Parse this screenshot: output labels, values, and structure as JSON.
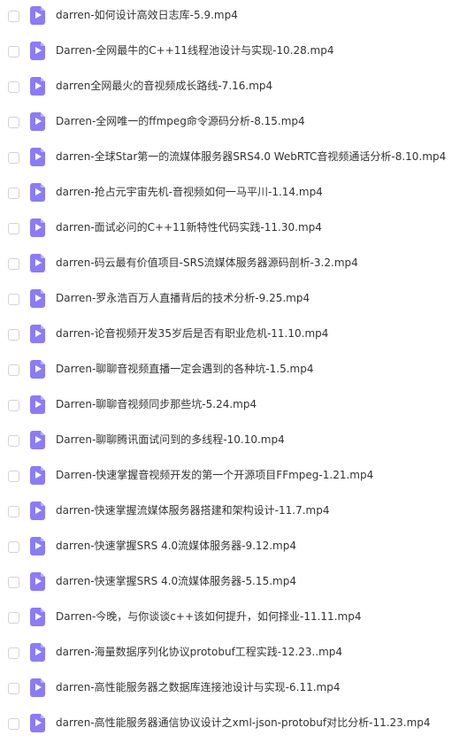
{
  "files": [
    {
      "name": "darren-如何设计高效日志库-5.9.mp4",
      "icon": "video-file-icon"
    },
    {
      "name": "Darren-全网最牛的C++11线程池设计与实现-10.28.mp4",
      "icon": "video-file-icon"
    },
    {
      "name": "darren全网最火的音视频成长路线-7.16.mp4",
      "icon": "video-file-icon"
    },
    {
      "name": "Darren-全网唯一的ffmpeg命令源码分析-8.15.mp4",
      "icon": "video-file-icon"
    },
    {
      "name": "darren-全球Star第一的流媒体服务器SRS4.0 WebRTC音视频通话分析-8.10.mp4",
      "icon": "video-file-icon"
    },
    {
      "name": "darren-抢占元宇宙先机-音视频如何一马平川-1.14.mp4",
      "icon": "video-file-icon"
    },
    {
      "name": "darren-面试必问的C++11新特性代码实践-11.30.mp4",
      "icon": "video-file-icon"
    },
    {
      "name": "darren-码云最有价值项目-SRS流媒体服务器源码剖析-3.2.mp4",
      "icon": "video-file-icon"
    },
    {
      "name": "Darren-罗永浩百万人直播背后的技术分析-9.25.mp4",
      "icon": "video-file-icon"
    },
    {
      "name": "darren-论音视频开发35岁后是否有职业危机-11.10.mp4",
      "icon": "video-file-icon"
    },
    {
      "name": "Darren-聊聊音视频直播一定会遇到的各种坑-1.5.mp4",
      "icon": "video-file-icon"
    },
    {
      "name": "Darren-聊聊音视频同步那些坑-5.24.mp4",
      "icon": "video-file-icon"
    },
    {
      "name": "Darren-聊聊腾讯面试问到的多线程-10.10.mp4",
      "icon": "video-file-icon"
    },
    {
      "name": "Darren-快速掌握音视频开发的第一个开源项目FFmpeg-1.21.mp4",
      "icon": "video-file-icon"
    },
    {
      "name": "darren-快速掌握流媒体服务器搭建和架构设计-11.7.mp4",
      "icon": "video-file-icon"
    },
    {
      "name": "darren-快速掌握SRS 4.0流媒体服务器-9.12.mp4",
      "icon": "video-file-icon"
    },
    {
      "name": "darren-快速掌握SRS 4.0流媒体服务器-5.15.mp4",
      "icon": "video-file-icon"
    },
    {
      "name": "Darren-今晚，与你谈谈c++该如何提升，如何择业-11.11.mp4",
      "icon": "video-file-icon"
    },
    {
      "name": "darren-海量数据序列化协议protobuf工程实践-12.23..mp4",
      "icon": "video-file-icon"
    },
    {
      "name": "darren-高性能服务器之数据库连接池设计与实现-6.11.mp4",
      "icon": "video-file-icon"
    },
    {
      "name": "darren-高性能服务器通信协议设计之xml-json-protobuf对比分析-11.23.mp4",
      "icon": "video-file-icon"
    }
  ],
  "colors": {
    "icon": "#8b7cf6",
    "text": "#333333",
    "checkbox_border": "#d3d3d3"
  }
}
